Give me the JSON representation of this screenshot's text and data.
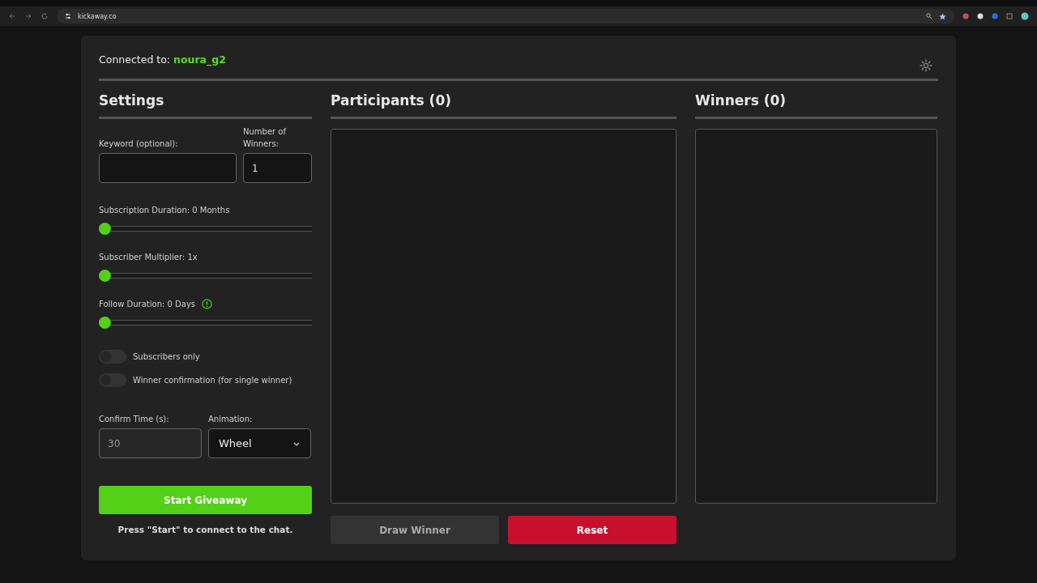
{
  "browser": {
    "address": "kickaway.co"
  },
  "connection": {
    "label": "Connected to:",
    "user": "noura_g2"
  },
  "settings": {
    "title": "Settings",
    "keyword": {
      "label": "Keyword (optional):"
    },
    "winners_count": {
      "label": "Number of Winners:",
      "value": "1"
    },
    "sliders": [
      {
        "label": "Subscription Duration: 0 Months",
        "level": 0,
        "info": false
      },
      {
        "label": "Subscriber Multiplier: 1x",
        "level": 0,
        "info": false
      },
      {
        "label": "Follow Duration: 0 Days",
        "level": 0,
        "info": true
      }
    ],
    "toggles": [
      {
        "label": "Subscribers only",
        "on": false
      },
      {
        "label": "Winner confirmation (for single winner)",
        "on": false
      }
    ],
    "confirm_time": {
      "label": "Confirm Time (s):",
      "placeholder": "30"
    },
    "animation": {
      "label": "Animation:",
      "value": "Wheel"
    },
    "start_button": "Start Giveaway",
    "hint": "Press \"Start\" to connect to the chat."
  },
  "participants": {
    "title": "Participants (0)",
    "draw_button": {
      "label": "Draw Winner",
      "disabled": true
    },
    "reset_button": "Reset"
  },
  "winners": {
    "title": "Winners (0)"
  }
}
